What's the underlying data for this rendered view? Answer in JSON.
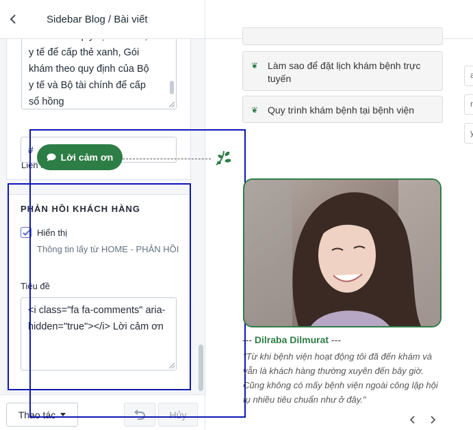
{
  "header": {
    "title": "Sidebar Blog / Bài viết",
    "back_icon": "chevron-left-icon"
  },
  "panel": {
    "textarea_prev_lines": [
      "khám theo quy định của Bộ",
      "y tế để cấp thẻ xanh, Gói",
      "khám theo quy định của Bộ",
      "y tế và Bộ tài chính để cấp",
      "sổ hồng"
    ],
    "link5_label": "Liên kết 5 (nếu có)",
    "link5_value": "#",
    "section_title": "PHẢN HỒI KHÁCH HÀNG",
    "show_label": "Hiển thị",
    "show_checked": true,
    "show_help": "Thông tin lấy từ HOME - PHẢN HỒI",
    "title_label": "Tiêu đề",
    "title_value": "<i class=\"fa fa-comments\" aria-hidden=\"true\"></i> Lời cảm ơn"
  },
  "footer": {
    "actions_label": "Thao tác",
    "undo_icon": "undo-icon",
    "cancel_label": "Hủy"
  },
  "preview": {
    "links": [
      {
        "text": "Làm sao để đặt lịch khám bệnh trực tuyến",
        "icon": "leaf-icon"
      },
      {
        "text": "Quy trình khám bệnh tại bệnh viện",
        "icon": "leaf-icon"
      }
    ],
    "stubs": [
      "a",
      "n",
      "y"
    ],
    "testimonial_title": "Lời cảm ơn",
    "testimonial_icon": "comments-icon",
    "customer_name": "Dilraba Dilmurat",
    "name_prefix": "---",
    "name_suffix": "---",
    "quote": "\"Từ khi bệnh viện hoạt động tôi đã đến khám và vẫn là khách hàng thường xuyên đến bây giờ. Cũng không có mấy bệnh viện ngoài công lập hội tụ nhiều tiêu chuẩn như ở đây.\"",
    "prev_icon": "chevron-left-icon",
    "next_icon": "chevron-right-icon",
    "accent_color": "#2d7d46",
    "highlight_color": "#0b15b3"
  }
}
